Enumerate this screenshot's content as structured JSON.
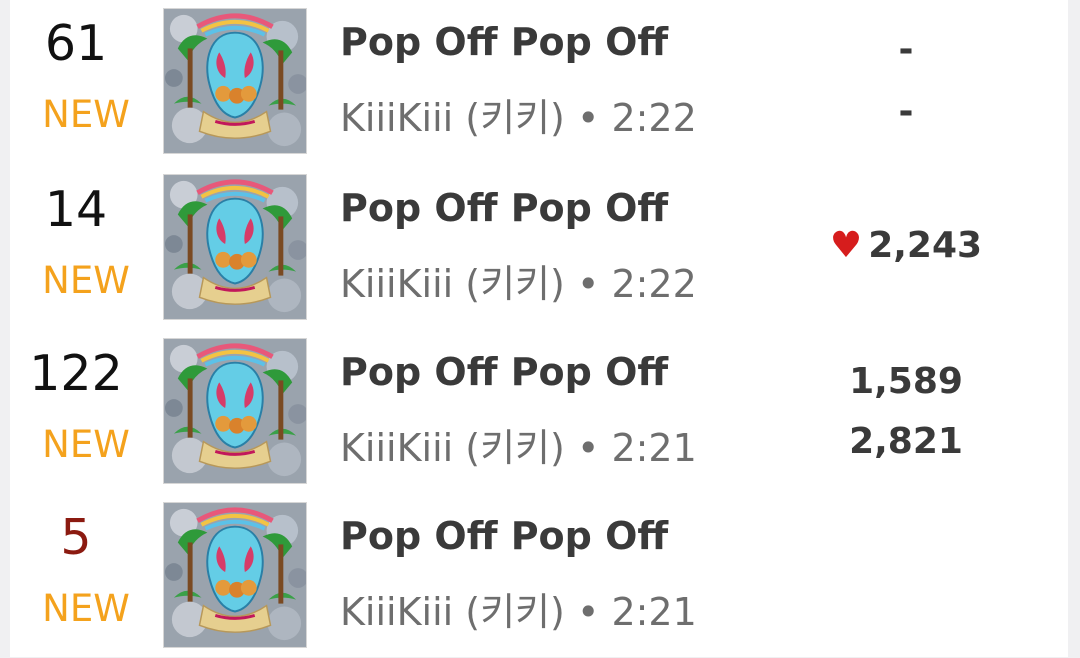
{
  "tracks": [
    {
      "rank": "61",
      "badge": "NEW",
      "title": "Pop Off Pop Off",
      "artist": "KiiiKiii (키키)",
      "sep": "•",
      "duration": "2:22",
      "stat_primary": "-",
      "stat_secondary": "-"
    },
    {
      "rank": "14",
      "badge": "NEW",
      "title": "Pop Off Pop Off",
      "artist": "KiiiKiii (키키)",
      "sep": "•",
      "duration": "2:22",
      "likes_icon": "heart-icon",
      "likes": "2,243"
    },
    {
      "rank": "122",
      "badge": "NEW",
      "title": "Pop Off Pop Off",
      "artist": "KiiiKiii (키키)",
      "sep": "•",
      "duration": "2:21",
      "stat_primary": "1,589",
      "stat_secondary": "2,821"
    },
    {
      "rank": "5",
      "badge": "NEW",
      "title": "Pop Off Pop Off",
      "artist": "KiiiKiii (키키)",
      "sep": "•",
      "duration": "2:21"
    }
  ],
  "colors": {
    "new_badge": "#f4a21d",
    "rank_highlight": "#8b1a10",
    "heart": "#d61d1d"
  }
}
